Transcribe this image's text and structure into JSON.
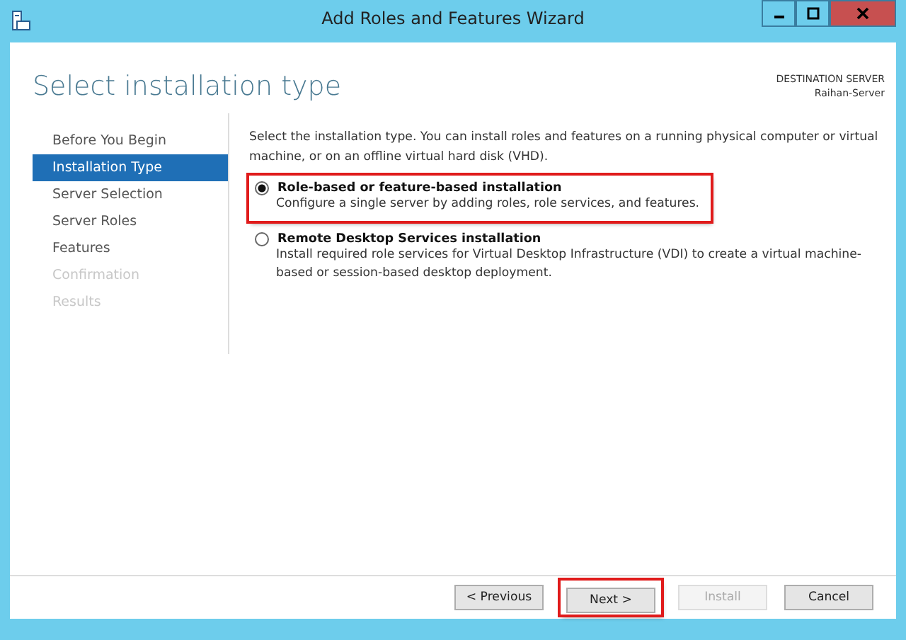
{
  "window": {
    "title": "Add Roles and Features Wizard"
  },
  "header": {
    "title": "Select installation type",
    "destination_label": "DESTINATION SERVER",
    "destination_server": "Raihan-Server"
  },
  "nav": [
    {
      "label": "Before You Begin",
      "selected": false,
      "disabled": false
    },
    {
      "label": "Installation Type",
      "selected": true,
      "disabled": false
    },
    {
      "label": "Server Selection",
      "selected": false,
      "disabled": false
    },
    {
      "label": "Server Roles",
      "selected": false,
      "disabled": false
    },
    {
      "label": "Features",
      "selected": false,
      "disabled": false
    },
    {
      "label": "Confirmation",
      "selected": false,
      "disabled": true
    },
    {
      "label": "Results",
      "selected": false,
      "disabled": true
    }
  ],
  "intro": "Select the installation type. You can install roles and features on a running physical computer or virtual machine, or on an offline virtual hard disk (VHD).",
  "options": [
    {
      "label": "Role-based or feature-based installation",
      "description": "Configure a single server by adding roles, role services, and features.",
      "selected": true,
      "highlighted": true
    },
    {
      "label": "Remote Desktop Services installation",
      "description": "Install required role services for Virtual Desktop Infrastructure (VDI) to create a virtual machine-based or session-based desktop deployment.",
      "selected": false,
      "highlighted": false
    }
  ],
  "buttons": [
    {
      "label": "< Previous",
      "disabled": false,
      "highlighted": false
    },
    {
      "label": "Next >",
      "disabled": false,
      "highlighted": true
    },
    {
      "label": "Install",
      "disabled": true,
      "highlighted": false
    },
    {
      "label": "Cancel",
      "disabled": false,
      "highlighted": false
    }
  ]
}
